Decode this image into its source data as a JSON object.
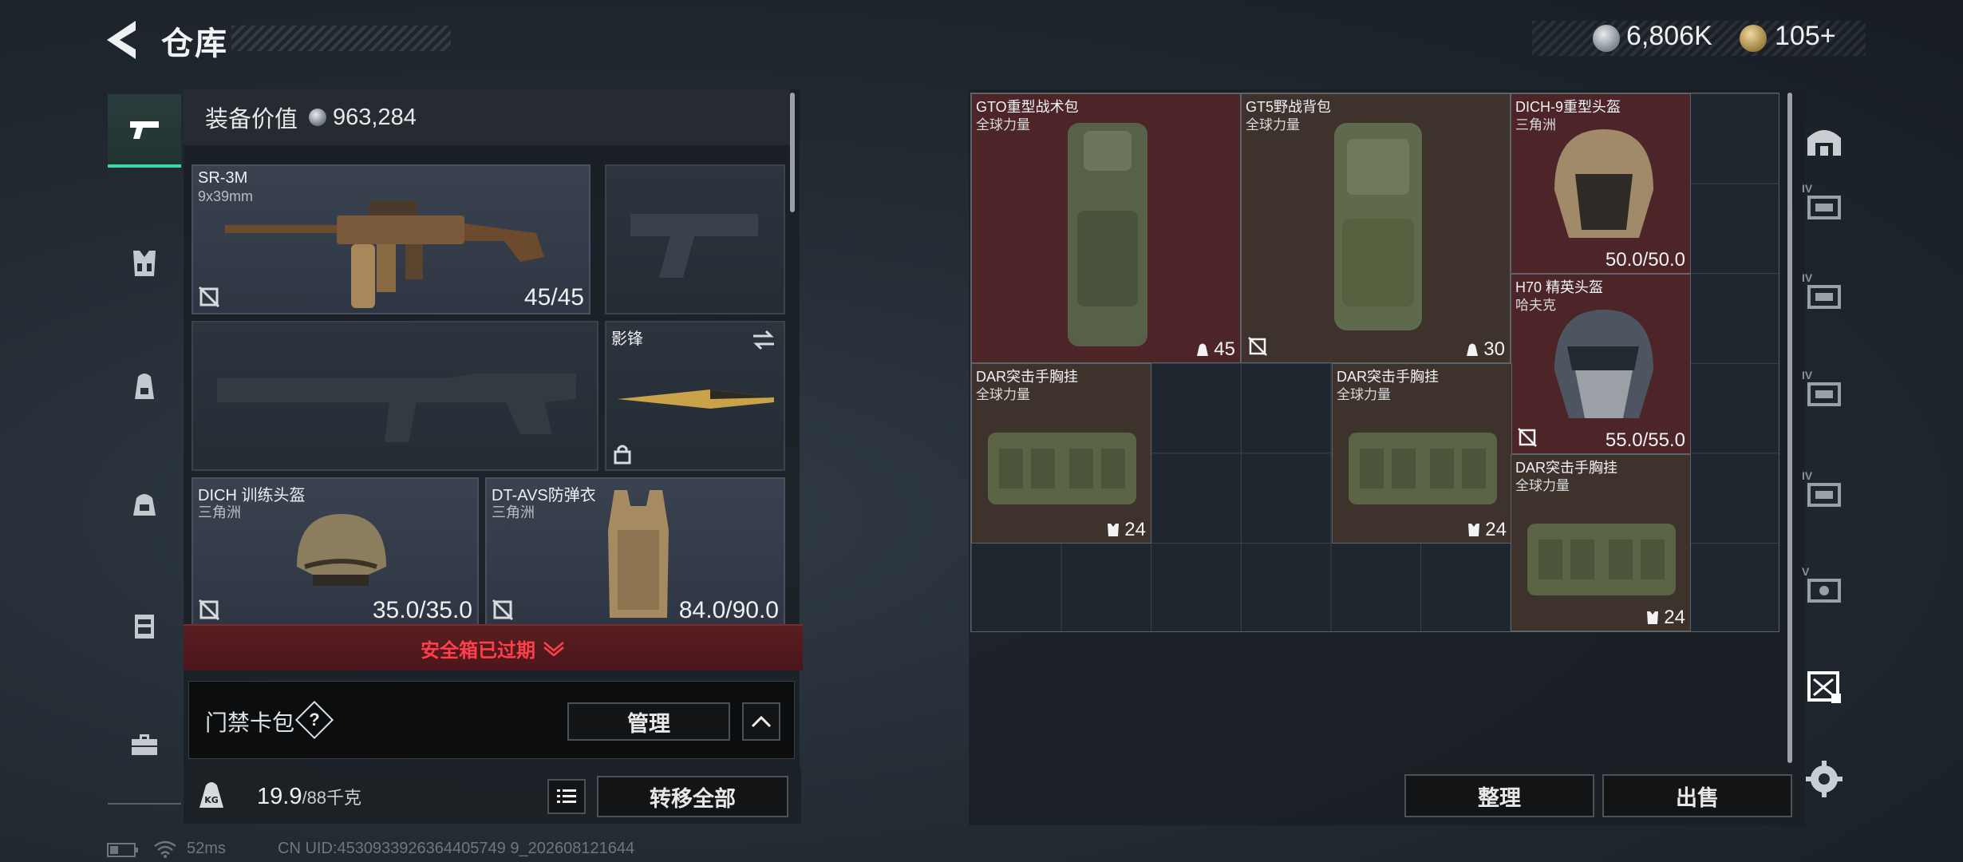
{
  "header": {
    "title": "仓库",
    "coin_value": "6,806K",
    "token_value": "105+"
  },
  "nav": {
    "items": [
      {
        "name": "weapons",
        "icon": "pistol-icon",
        "active": true
      },
      {
        "name": "chest-rig",
        "icon": "chest-rig-icon",
        "active": false
      },
      {
        "name": "backpack",
        "icon": "backpack-icon",
        "active": false
      },
      {
        "name": "bag",
        "icon": "bag-icon",
        "active": false
      },
      {
        "name": "case",
        "icon": "case-icon",
        "active": false
      },
      {
        "name": "toolbox",
        "icon": "toolbox-icon",
        "active": false
      }
    ]
  },
  "equipment": {
    "value_label": "装备价值",
    "value": "963,284",
    "primary_weapon": {
      "name": "SR-3M",
      "sub": "9x39mm",
      "ammo": "45/45"
    },
    "melee": {
      "name": "影锋"
    },
    "helmet": {
      "name": "DICH 训练头盔",
      "sub": "三角洲",
      "durability": "35.0/35.0"
    },
    "armor": {
      "name": "DT-AVS防弹衣",
      "sub": "三角洲",
      "durability": "84.0/90.0"
    },
    "safe_box_status": "安全箱已过期",
    "keycard_label": "门禁卡包",
    "help_symbol": "?",
    "manage_label": "管理",
    "weight_value": "19.9",
    "weight_max": "/88千克",
    "transfer_all_label": "转移全部"
  },
  "storage": {
    "items": [
      {
        "name": "GTO重型战术包",
        "sub": "全球力量",
        "badge": "45",
        "badge_icon": "backpack-icon",
        "color": "red"
      },
      {
        "name": "GT5野战背包",
        "sub": "全球力量",
        "badge": "30",
        "badge_icon": "backpack-icon",
        "color": "brown"
      },
      {
        "name": "DICH-9重型头盔",
        "sub": "三角洲",
        "value": "50.0/50.0",
        "color": "red"
      },
      {
        "name": "H70 精英头盔",
        "sub": "哈夫克",
        "value": "55.0/55.0",
        "color": "red"
      },
      {
        "name": "DAR突击手胸挂",
        "sub": "全球力量",
        "badge": "24",
        "badge_icon": "chest-rig-icon",
        "color": "brown"
      },
      {
        "name": "DAR突击手胸挂",
        "sub": "全球力量",
        "badge": "24",
        "badge_icon": "chest-rig-icon",
        "color": "brown"
      },
      {
        "name": "DAR突击手胸挂",
        "sub": "全球力量",
        "badge": "24",
        "badge_icon": "chest-rig-icon",
        "color": "brown"
      }
    ],
    "sort_label": "整理",
    "sell_label": "出售"
  },
  "side_nav": {
    "items": [
      {
        "icon": "warehouse-icon",
        "tier": ""
      },
      {
        "icon": "storage-tier-icon",
        "tier": "IV"
      },
      {
        "icon": "storage-tier-icon",
        "tier": "IV"
      },
      {
        "icon": "storage-tier-icon",
        "tier": "IV"
      },
      {
        "icon": "storage-tier-icon",
        "tier": "IV"
      },
      {
        "icon": "storage-tier-icon",
        "tier": "V"
      },
      {
        "icon": "storage-active-icon",
        "tier": ""
      },
      {
        "icon": "gear-icon",
        "tier": ""
      }
    ]
  },
  "status": {
    "ping": "52ms",
    "uid": "CN UID:4530933926364405749 9_202608121644"
  },
  "colors": {
    "accent": "#3fd7a6",
    "alert": "#ff3f4a",
    "red_item": "#4d2428",
    "brown_item": "#3e322d"
  }
}
